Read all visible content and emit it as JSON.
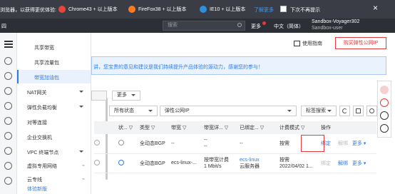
{
  "notice": {
    "text": "浏览器，以获得更优体验:",
    "browsers": [
      {
        "label": "Chrome43 + 以上版本",
        "color": "#e8453c"
      },
      {
        "label": "FireFox38 + 以上版本",
        "color": "#ff7b21"
      },
      {
        "label": "IE10 + 以上版本",
        "color": "#2e8ee0"
      }
    ],
    "more_link": "了解更多",
    "dont_remind": "下次不再提示",
    "close": "×"
  },
  "header": {
    "crumb": "四",
    "search_placeholder": "搜索",
    "more": "更多",
    "language": "中文（简体）",
    "account": "Sandbox-Voyager302",
    "user": "Sandbox-user"
  },
  "sidebar": {
    "items": [
      {
        "label": "共享带宽",
        "sub": true
      },
      {
        "label": "共享流量包",
        "sub": true
      },
      {
        "label": "带宽加油包",
        "sub": true,
        "selected": true
      },
      {
        "label": "NAT网关",
        "expandable": true
      },
      {
        "label": "弹性负载均衡",
        "expandable": true
      },
      {
        "label": "对等连接"
      },
      {
        "label": "企业交换机"
      },
      {
        "label": "VPC 终端节点",
        "expandable": true
      },
      {
        "label": "虚拟专用网络",
        "pinned": true
      },
      {
        "label": "云专线",
        "pinned": true
      }
    ],
    "new_version": "体验新版"
  },
  "toolbar": {
    "guide": "使用指南",
    "buy": "购买弹性公网IP",
    "banner": "讲，您宝贵的意见和建议是我们持续提升产品体验的源动力，感谢您的参与！",
    "more_btn": "更多",
    "status_filter": "所有状态",
    "field_filter": "弹性公网IP",
    "tag_search": "标签搜索"
  },
  "table": {
    "headers": [
      "状...",
      "类型",
      "带宽",
      "带宽详...",
      "已绑定...",
      "计费模式",
      "操作"
    ],
    "rows": [
      {
        "type": "全动态BGP",
        "bandwidth": "--",
        "bandwidth_detail": [
          "--",
          "--"
        ],
        "bound": "--",
        "billing": [
          "按需"
        ],
        "bind": "绑定",
        "unbind": "解绑",
        "more": "更多",
        "bind_enabled": true
      },
      {
        "type": "全动态BGP",
        "bandwidth": "ecs-linux-...",
        "bandwidth_detail": [
          "按带宽计费",
          "1 Mbit/s"
        ],
        "bound": [
          "ecs-linux",
          "云服务器"
        ],
        "billing": [
          "按需",
          "2022/04/02 1..."
        ],
        "bind": "绑定",
        "unbind": "解绑",
        "more": "更多",
        "bind_enabled": false
      }
    ]
  }
}
